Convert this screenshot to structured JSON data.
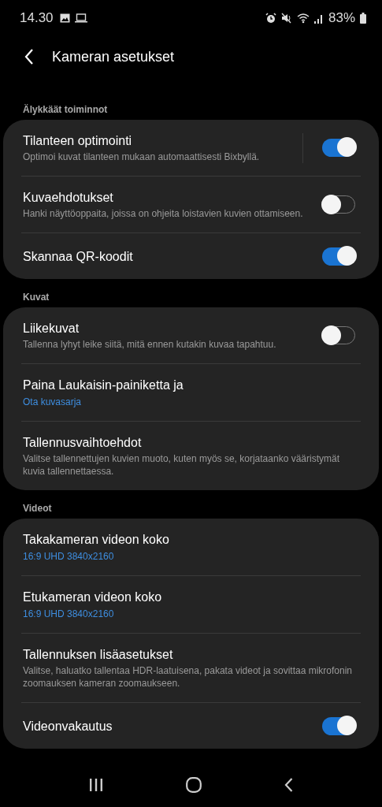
{
  "status_bar": {
    "time": "14.30",
    "battery": "83%"
  },
  "header": {
    "title": "Kameran asetukset"
  },
  "sections": [
    {
      "title": "Älykkäät toiminnot",
      "items": [
        {
          "kind": "toggle",
          "title": "Tilanteen optimointi",
          "description": "Optimoi kuvat tilanteen mukaan automaattisesti Bixbyllä.",
          "on": true,
          "split": true
        },
        {
          "kind": "toggle",
          "title": "Kuvaehdotukset",
          "description": "Hanki näyttöoppaita, joissa on ohjeita loistavien kuvien ottamiseen.",
          "on": false,
          "split": false
        },
        {
          "kind": "toggle",
          "title": "Skannaa QR-koodit",
          "on": true,
          "split": false
        }
      ]
    },
    {
      "title": "Kuvat",
      "items": [
        {
          "kind": "toggle",
          "title": "Liikekuvat",
          "description": "Tallenna lyhyt leike siitä, mitä ennen kutakin kuvaa tapahtuu.",
          "on": false,
          "split": false
        },
        {
          "kind": "link",
          "title": "Paina Laukaisin-painiketta ja",
          "value": "Ota kuvasarja"
        },
        {
          "kind": "link",
          "title": "Tallennusvaihtoehdot",
          "description": "Valitse tallennettujen kuvien muoto, kuten myös se, korjataanko vääristymät kuvia tallennettaessa."
        }
      ]
    },
    {
      "title": "Videot",
      "items": [
        {
          "kind": "link",
          "title": "Takakameran videon koko",
          "value": "16:9 UHD 3840x2160"
        },
        {
          "kind": "link",
          "title": "Etukameran videon koko",
          "value": "16:9 UHD 3840x2160"
        },
        {
          "kind": "link",
          "title": "Tallennuksen lisäasetukset",
          "description": "Valitse, haluatko tallentaa HDR-laatuisena, pakata videot ja sovittaa mikrofonin zoomauksen kameran zoomaukseen."
        },
        {
          "kind": "toggle",
          "title": "Videonvakautus",
          "on": true,
          "split": false
        }
      ]
    }
  ]
}
